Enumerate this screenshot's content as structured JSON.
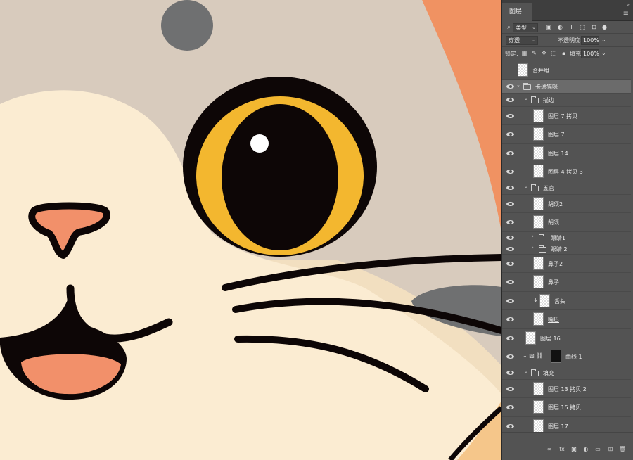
{
  "panel": {
    "tab_title": "图层",
    "filter": {
      "kind_label": "类型"
    },
    "blend_mode": "穿透",
    "opacity_label": "不透明度:",
    "opacity_value": "100%",
    "lock_label": "锁定:",
    "fill_label": "填充:",
    "fill_value": "100%",
    "layers": [
      {
        "name": "合并组",
        "kind": "layer",
        "indent": 0,
        "visible": false
      },
      {
        "name": "卡通猫咪",
        "kind": "group",
        "indent": 0,
        "visible": true,
        "selected": true
      },
      {
        "name": "描边",
        "kind": "group",
        "indent": 1,
        "visible": true
      },
      {
        "name": "图层 7 拷贝",
        "kind": "layer",
        "indent": 2,
        "visible": true
      },
      {
        "name": "图层 7",
        "kind": "layer",
        "indent": 2,
        "visible": true
      },
      {
        "name": "图层 14",
        "kind": "layer",
        "indent": 2,
        "visible": true
      },
      {
        "name": "图层 4 拷贝 3",
        "kind": "layer",
        "indent": 2,
        "visible": true
      },
      {
        "name": "五官",
        "kind": "group",
        "indent": 1,
        "visible": true
      },
      {
        "name": "胡须2",
        "kind": "layer",
        "indent": 2,
        "visible": true
      },
      {
        "name": "胡须",
        "kind": "layer",
        "indent": 2,
        "visible": true
      },
      {
        "name": "眼睛1",
        "kind": "group-closed",
        "indent": 2,
        "visible": true
      },
      {
        "name": "眼睛 2",
        "kind": "group-closed",
        "indent": 2,
        "visible": true
      },
      {
        "name": "鼻子2",
        "kind": "layer",
        "indent": 2,
        "visible": true
      },
      {
        "name": "鼻子",
        "kind": "layer",
        "indent": 2,
        "visible": true
      },
      {
        "name": "舌头",
        "kind": "clipped",
        "indent": 2,
        "visible": true
      },
      {
        "name": "嘴巴",
        "kind": "layer",
        "indent": 2,
        "visible": true,
        "underline": true
      },
      {
        "name": "图层 16",
        "kind": "layer",
        "indent": 1,
        "visible": true
      },
      {
        "name": "曲线 1",
        "kind": "adjustment",
        "indent": 1,
        "visible": true
      },
      {
        "name": "填充",
        "kind": "group",
        "indent": 1,
        "visible": true,
        "underline": true
      },
      {
        "name": "图层 13 拷贝 2",
        "kind": "layer",
        "indent": 2,
        "visible": true
      },
      {
        "name": "图层 15 拷贝",
        "kind": "layer",
        "indent": 2,
        "visible": true
      },
      {
        "name": "图层 17",
        "kind": "layer",
        "indent": 2,
        "visible": true
      }
    ],
    "footer_icons": [
      "link-icon",
      "fx-icon",
      "mask-icon",
      "adjustment-icon",
      "new-group-icon",
      "new-layer-icon",
      "trash-icon"
    ]
  },
  "colors": {
    "gray_head": "#d8cbbd",
    "cream_face": "#fbecd2",
    "orange": "#f09262",
    "eye_yellow": "#f3b72f",
    "ink": "#0d0606",
    "tongue": "#f2906a",
    "spot": "#6f7071",
    "panel_bg": "#535353"
  }
}
